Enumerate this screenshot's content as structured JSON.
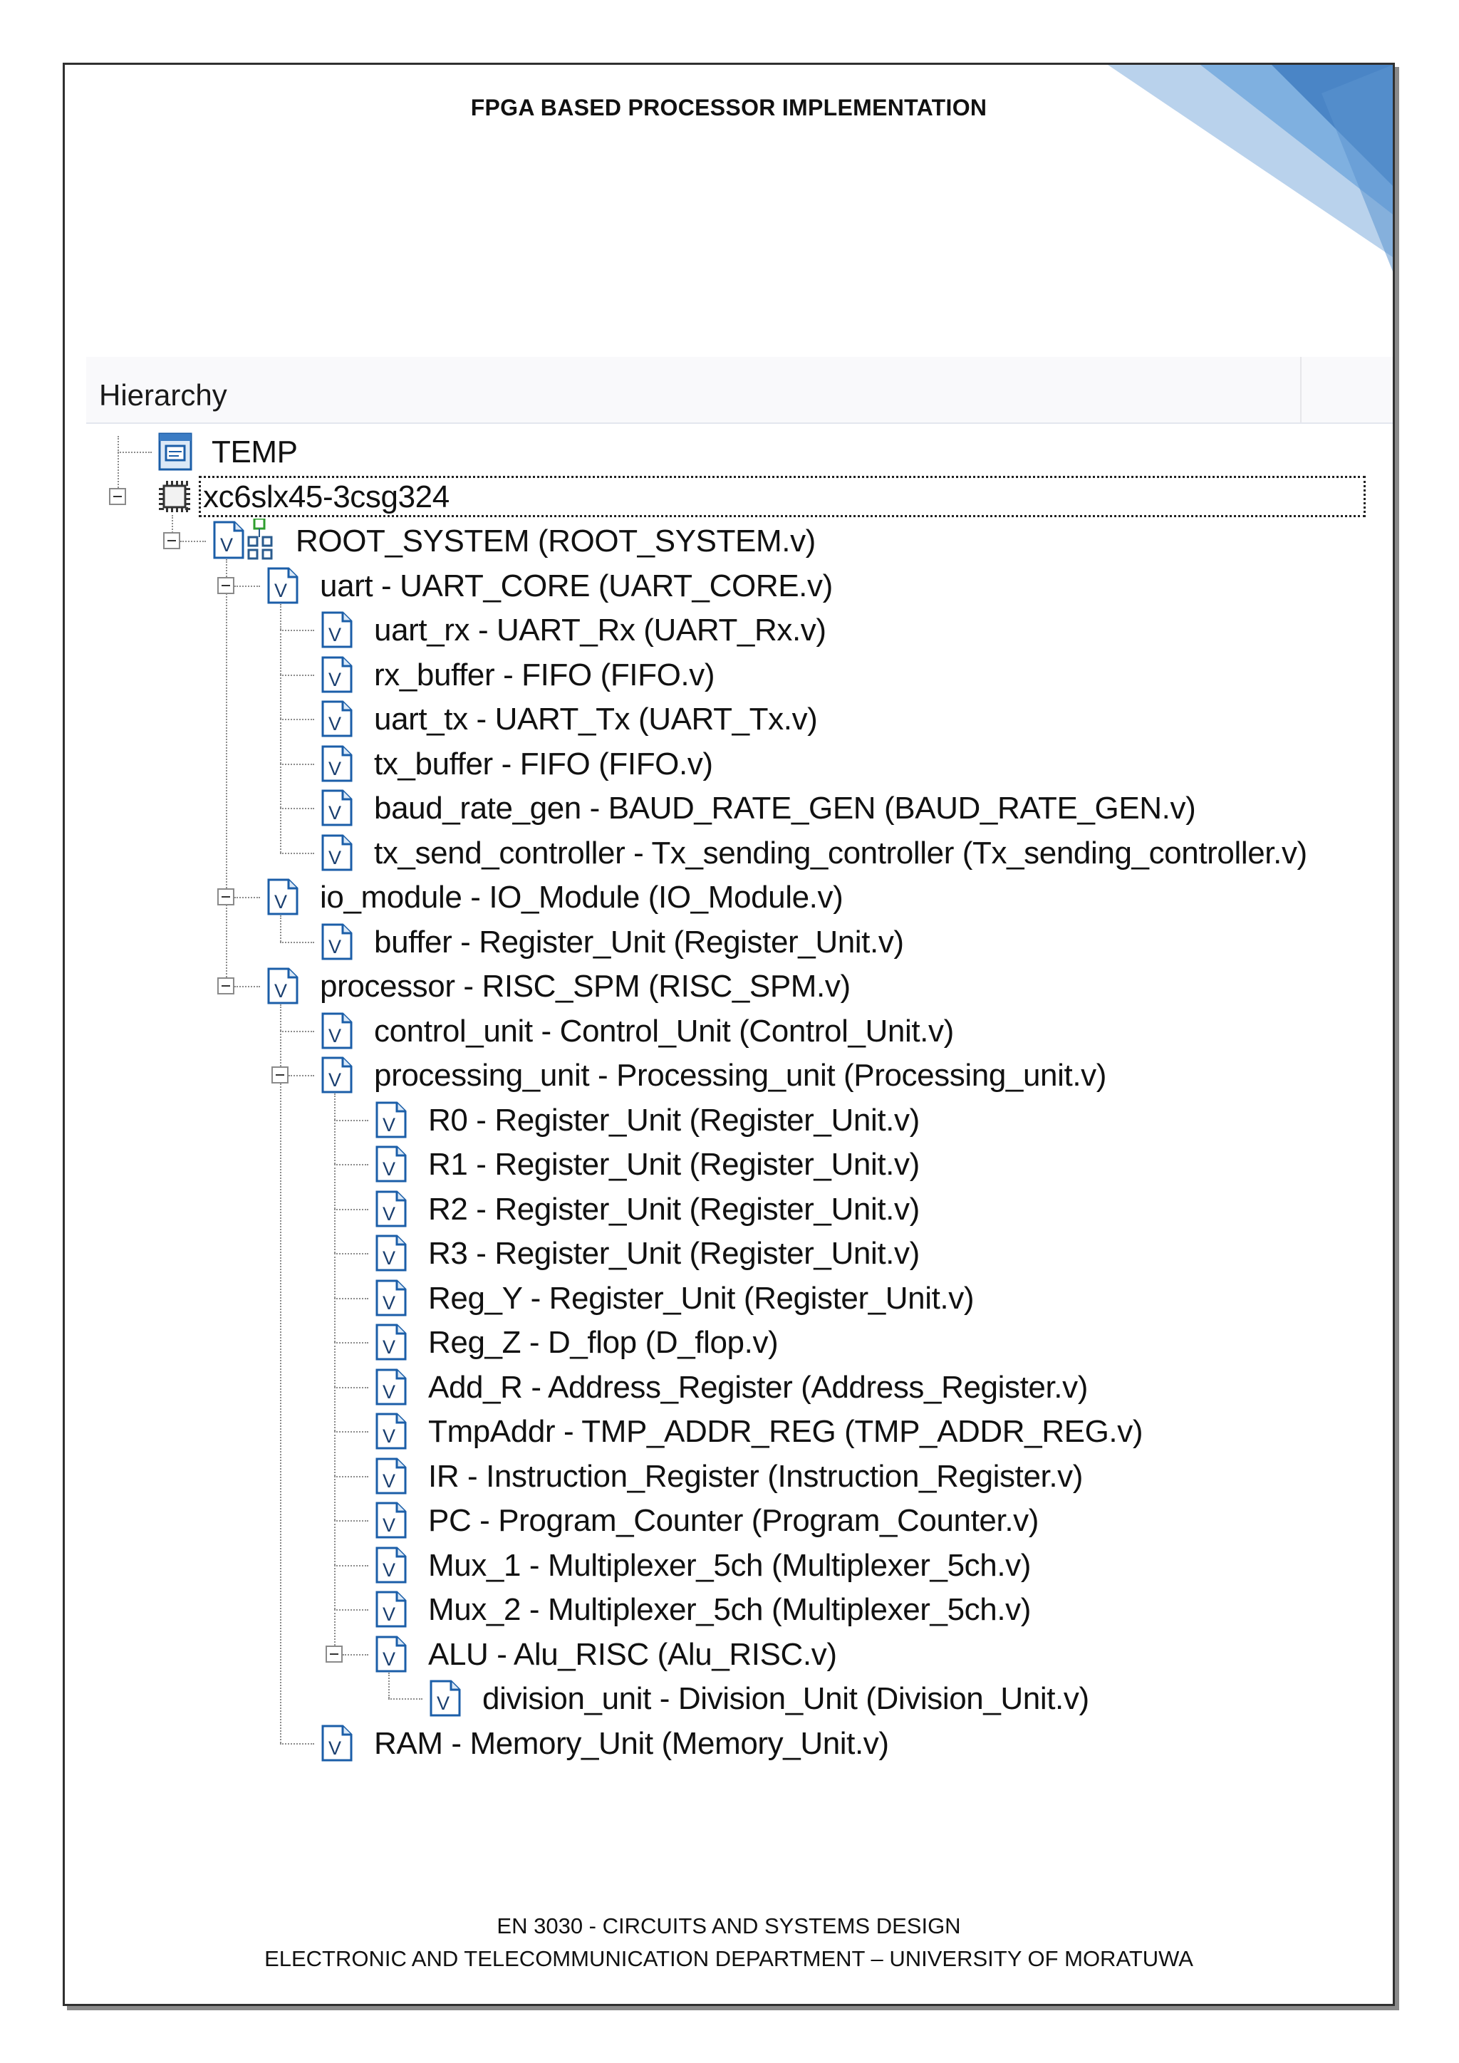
{
  "header_text": "FPGA BASED PROCESSOR IMPLEMENTATION",
  "footer": {
    "line1": "EN 3030 - CIRCUITS AND SYSTEMS DESIGN",
    "line2": "ELECTRONIC AND TELECOMMUNICATION DEPARTMENT – UNIVERSITY OF MORATUWA"
  },
  "colors": {
    "frame": "#303030",
    "deco_dark": "#4a85c6",
    "deco_light": "#b9d2ec",
    "verilog_icon": "#1b5ea8",
    "tree_line": "#8c8c8c"
  },
  "hierarchy": {
    "title": "Hierarchy",
    "nodes": [
      {
        "label": "TEMP",
        "icon": "project-icon",
        "depth": 0,
        "expander": "none",
        "selected": false
      },
      {
        "label": "xc6slx45-3csg324",
        "icon": "chip-icon",
        "depth": 0,
        "expander": "collapse",
        "selected": true
      },
      {
        "label": "ROOT_SYSTEM (ROOT_SYSTEM.v)",
        "icon": "verilog-top-module-icon",
        "depth": 1,
        "expander": "collapse",
        "selected": false
      },
      {
        "label": "uart - UART_CORE (UART_CORE.v)",
        "icon": "verilog-file-icon",
        "depth": 2,
        "expander": "collapse",
        "selected": false
      },
      {
        "label": "uart_rx - UART_Rx (UART_Rx.v)",
        "icon": "verilog-file-icon",
        "depth": 3,
        "expander": "none",
        "selected": false
      },
      {
        "label": "rx_buffer - FIFO (FIFO.v)",
        "icon": "verilog-file-icon",
        "depth": 3,
        "expander": "none",
        "selected": false
      },
      {
        "label": "uart_tx - UART_Tx (UART_Tx.v)",
        "icon": "verilog-file-icon",
        "depth": 3,
        "expander": "none",
        "selected": false
      },
      {
        "label": "tx_buffer - FIFO (FIFO.v)",
        "icon": "verilog-file-icon",
        "depth": 3,
        "expander": "none",
        "selected": false
      },
      {
        "label": "baud_rate_gen - BAUD_RATE_GEN (BAUD_RATE_GEN.v)",
        "icon": "verilog-file-icon",
        "depth": 3,
        "expander": "none",
        "selected": false
      },
      {
        "label": "tx_send_controller - Tx_sending_controller (Tx_sending_controller.v)",
        "icon": "verilog-file-icon",
        "depth": 3,
        "expander": "none",
        "selected": false
      },
      {
        "label": "io_module - IO_Module (IO_Module.v)",
        "icon": "verilog-file-icon",
        "depth": 2,
        "expander": "collapse",
        "selected": false
      },
      {
        "label": "buffer - Register_Unit (Register_Unit.v)",
        "icon": "verilog-file-icon",
        "depth": 3,
        "expander": "none",
        "selected": false
      },
      {
        "label": "processor - RISC_SPM (RISC_SPM.v)",
        "icon": "verilog-file-icon",
        "depth": 2,
        "expander": "collapse",
        "selected": false
      },
      {
        "label": "control_unit - Control_Unit (Control_Unit.v)",
        "icon": "verilog-file-icon",
        "depth": 3,
        "expander": "none",
        "selected": false
      },
      {
        "label": "processing_unit - Processing_unit (Processing_unit.v)",
        "icon": "verilog-file-icon",
        "depth": 3,
        "expander": "collapse",
        "selected": false
      },
      {
        "label": "R0 - Register_Unit (Register_Unit.v)",
        "icon": "verilog-file-icon",
        "depth": 4,
        "expander": "none",
        "selected": false
      },
      {
        "label": "R1 - Register_Unit (Register_Unit.v)",
        "icon": "verilog-file-icon",
        "depth": 4,
        "expander": "none",
        "selected": false
      },
      {
        "label": "R2 - Register_Unit (Register_Unit.v)",
        "icon": "verilog-file-icon",
        "depth": 4,
        "expander": "none",
        "selected": false
      },
      {
        "label": "R3 - Register_Unit (Register_Unit.v)",
        "icon": "verilog-file-icon",
        "depth": 4,
        "expander": "none",
        "selected": false
      },
      {
        "label": "Reg_Y - Register_Unit (Register_Unit.v)",
        "icon": "verilog-file-icon",
        "depth": 4,
        "expander": "none",
        "selected": false
      },
      {
        "label": "Reg_Z - D_flop (D_flop.v)",
        "icon": "verilog-file-icon",
        "depth": 4,
        "expander": "none",
        "selected": false
      },
      {
        "label": "Add_R - Address_Register (Address_Register.v)",
        "icon": "verilog-file-icon",
        "depth": 4,
        "expander": "none",
        "selected": false
      },
      {
        "label": "TmpAddr - TMP_ADDR_REG (TMP_ADDR_REG.v)",
        "icon": "verilog-file-icon",
        "depth": 4,
        "expander": "none",
        "selected": false
      },
      {
        "label": "IR - Instruction_Register (Instruction_Register.v)",
        "icon": "verilog-file-icon",
        "depth": 4,
        "expander": "none",
        "selected": false
      },
      {
        "label": "PC - Program_Counter (Program_Counter.v)",
        "icon": "verilog-file-icon",
        "depth": 4,
        "expander": "none",
        "selected": false
      },
      {
        "label": "Mux_1 - Multiplexer_5ch (Multiplexer_5ch.v)",
        "icon": "verilog-file-icon",
        "depth": 4,
        "expander": "none",
        "selected": false
      },
      {
        "label": "Mux_2 - Multiplexer_5ch (Multiplexer_5ch.v)",
        "icon": "verilog-file-icon",
        "depth": 4,
        "expander": "none",
        "selected": false
      },
      {
        "label": "ALU - Alu_RISC (Alu_RISC.v)",
        "icon": "verilog-file-icon",
        "depth": 4,
        "expander": "collapse",
        "selected": false
      },
      {
        "label": "division_unit - Division_Unit (Division_Unit.v)",
        "icon": "verilog-file-icon",
        "depth": 5,
        "expander": "none",
        "selected": false
      },
      {
        "label": "RAM - Memory_Unit (Memory_Unit.v)",
        "icon": "verilog-file-icon",
        "depth": 3,
        "expander": "none",
        "selected": false
      }
    ]
  }
}
